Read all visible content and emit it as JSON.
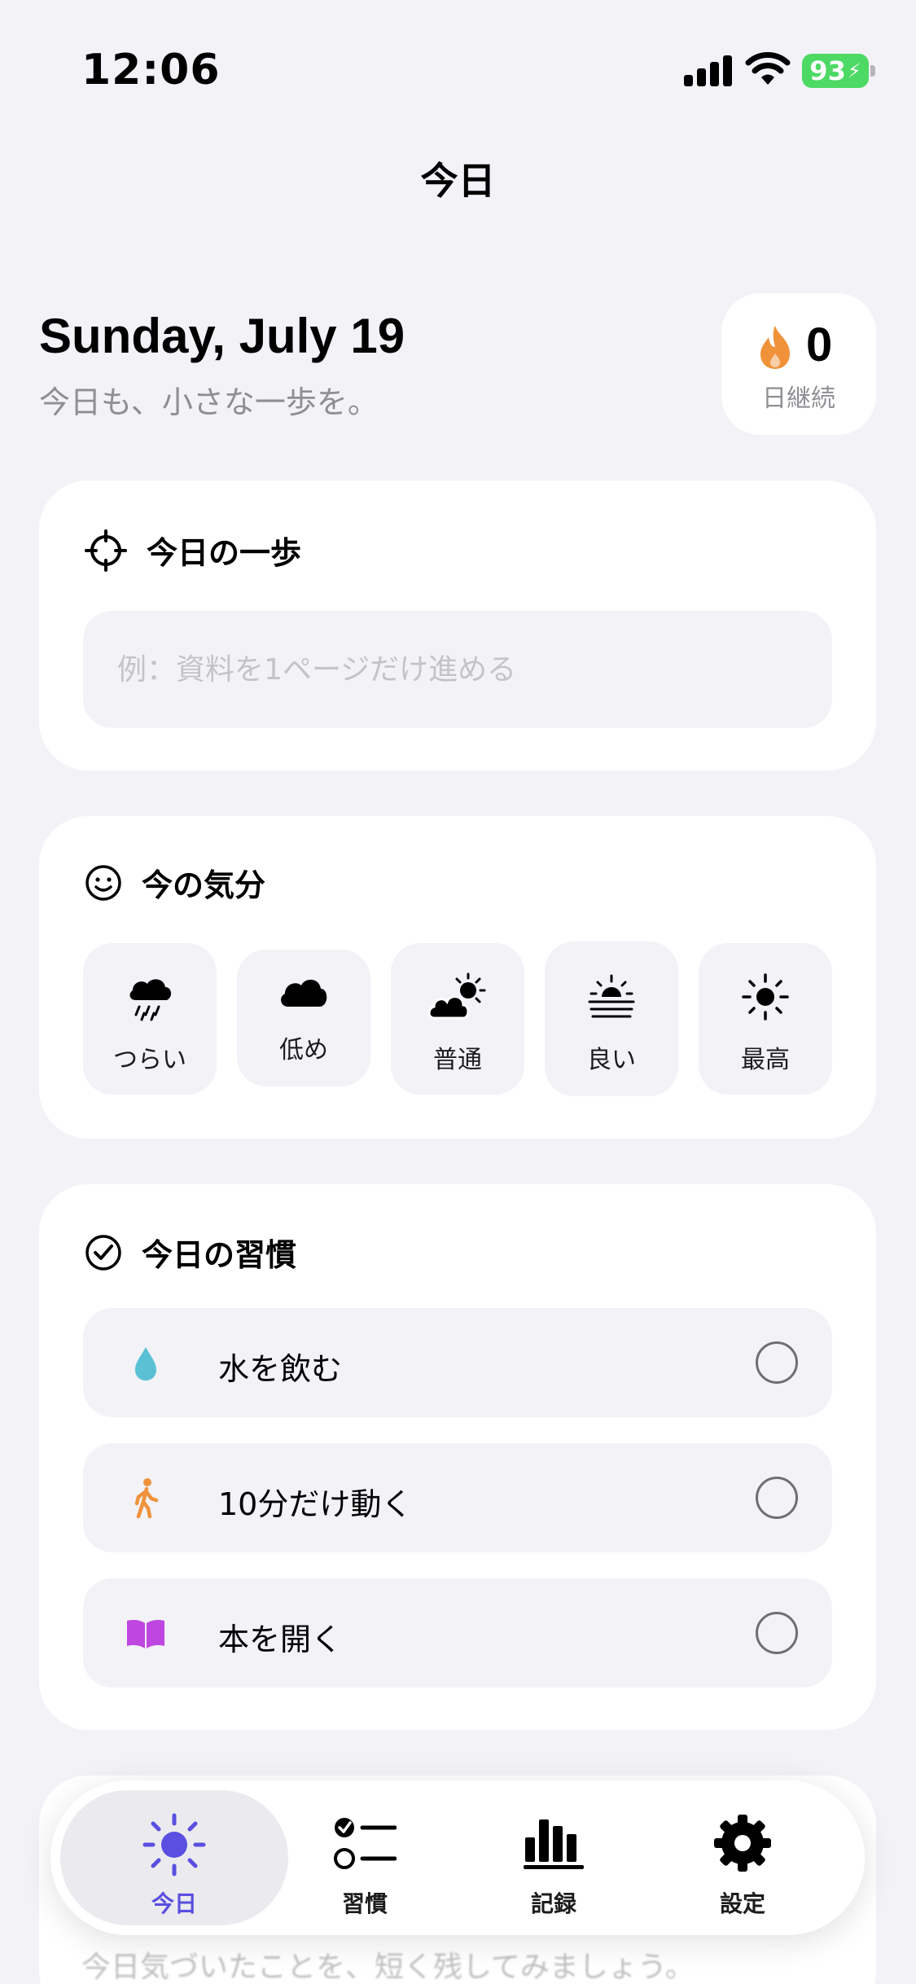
{
  "status_bar": {
    "time": "12:06",
    "battery": "93"
  },
  "nav": {
    "title": "今日"
  },
  "header": {
    "date": "Sunday, July 19",
    "subtitle": "今日も、小さな一歩を。"
  },
  "streak": {
    "count": "0",
    "label": "日継続"
  },
  "step_card": {
    "title": "今日の一歩",
    "placeholder": "例：資料を1ページだけ進める",
    "value": ""
  },
  "mood_card": {
    "title": "今の気分",
    "options": [
      {
        "label": "つらい",
        "icon": "cloud-rain-icon"
      },
      {
        "label": "低め",
        "icon": "cloud-icon"
      },
      {
        "label": "普通",
        "icon": "cloud-sun-icon"
      },
      {
        "label": "良い",
        "icon": "sunrise-icon"
      },
      {
        "label": "最高",
        "icon": "sun-icon"
      }
    ]
  },
  "habits_card": {
    "title": "今日の習慣",
    "items": [
      {
        "label": "水を飲む",
        "icon": "water-drop-icon",
        "color": "#5ac1d4",
        "done": false
      },
      {
        "label": "10分だけ動く",
        "icon": "walking-icon",
        "color": "#f0923a",
        "done": false
      },
      {
        "label": "本を開く",
        "icon": "book-icon",
        "color": "#bf46e0",
        "done": false
      }
    ]
  },
  "notes_card": {
    "hint": "今日気づいたことを、短く残してみましょう。"
  },
  "tabs": [
    {
      "label": "今日",
      "icon": "sun-icon",
      "active": true
    },
    {
      "label": "習慣",
      "icon": "checklist-icon",
      "active": false
    },
    {
      "label": "記録",
      "icon": "chart-icon",
      "active": false
    },
    {
      "label": "設定",
      "icon": "gear-icon",
      "active": false
    }
  ],
  "colors": {
    "accent": "#5a4fe0",
    "background": "#f2f2f7",
    "flame": "#f0923a",
    "battery": "#4cd964"
  }
}
